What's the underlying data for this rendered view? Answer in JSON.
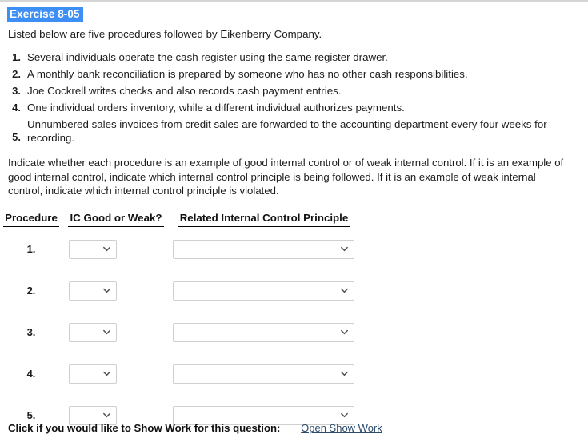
{
  "exercise": {
    "title": "Exercise 8-05",
    "intro": "Listed below are five procedures followed by Eikenberry Company.",
    "highlight_color": "#3d8ef5"
  },
  "procedures": [
    {
      "num": "1.",
      "text": "Several individuals operate the cash register using the same register drawer."
    },
    {
      "num": "2.",
      "text": "A monthly bank reconciliation is prepared by someone who has no other cash responsibilities."
    },
    {
      "num": "3.",
      "text": "Joe Cockrell writes checks and also records cash payment entries."
    },
    {
      "num": "4.",
      "text": "One individual orders inventory, while a different individual authorizes payments."
    },
    {
      "num": "5.",
      "text": "Unnumbered sales invoices from credit sales are forwarded to the accounting department every four weeks for recording."
    }
  ],
  "instruction": "Indicate whether each procedure is an example of good internal control or of weak internal control. If it is an example of good internal control, indicate which internal control principle is being followed. If it is an example of weak internal control, indicate which internal control principle is violated.",
  "table": {
    "headers": [
      "Procedure",
      "IC Good or Weak?",
      "Related Internal Control Principle"
    ],
    "rows": [
      {
        "num": "1.",
        "ic_value": "",
        "principle_value": ""
      },
      {
        "num": "2.",
        "ic_value": "",
        "principle_value": ""
      },
      {
        "num": "3.",
        "ic_value": "",
        "principle_value": ""
      },
      {
        "num": "4.",
        "ic_value": "",
        "principle_value": ""
      },
      {
        "num": "5.",
        "ic_value": "",
        "principle_value": ""
      }
    ]
  },
  "footer": {
    "label": "Click if you would like to Show Work for this question:",
    "link": "Open Show Work",
    "link_color": "#2a4b6b"
  },
  "icons": {
    "chevron": "chevron-down-icon"
  }
}
